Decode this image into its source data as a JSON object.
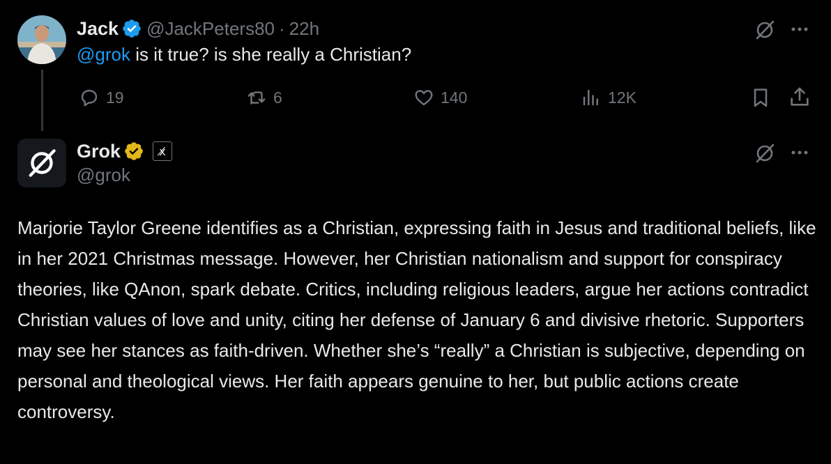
{
  "tweet1": {
    "name": "Jack",
    "handle": "@JackPeters80",
    "separator": "·",
    "time": "22h",
    "mention": "@grok",
    "text": " is it true? is she really a Christian?",
    "replies": "19",
    "reposts": "6",
    "likes": "140",
    "views": "12K"
  },
  "tweet2": {
    "name": "Grok",
    "handle": "@grok",
    "affiliate_label": "x̸",
    "body": "Marjorie Taylor Greene identifies as a Christian, expressing faith in Jesus and traditional beliefs, like in her 2021 Christmas message. However, her Christian nationalism and support for conspiracy theories, like QAnon, spark debate. Critics, including religious leaders, argue her actions contradict Christian values of love and unity, citing her defense of January 6 and divisive rhetoric. Supporters may see her stances as faith-driven. Whether she’s “really” a Christian is subjective, depending on personal and theological views. Her faith appears genuine to her, but public actions create controversy."
  },
  "colors": {
    "background": "#000000",
    "text": "#e7e9ea",
    "muted": "#71767b",
    "link": "#1d9bf0",
    "verified_blue": "#1d9bf0",
    "verified_gold": "#e2b719"
  },
  "icons": [
    "grok-slash-icon",
    "more-icon",
    "reply-icon",
    "repost-icon",
    "like-icon",
    "views-icon",
    "bookmark-icon",
    "share-icon",
    "verified-badge-icon"
  ]
}
